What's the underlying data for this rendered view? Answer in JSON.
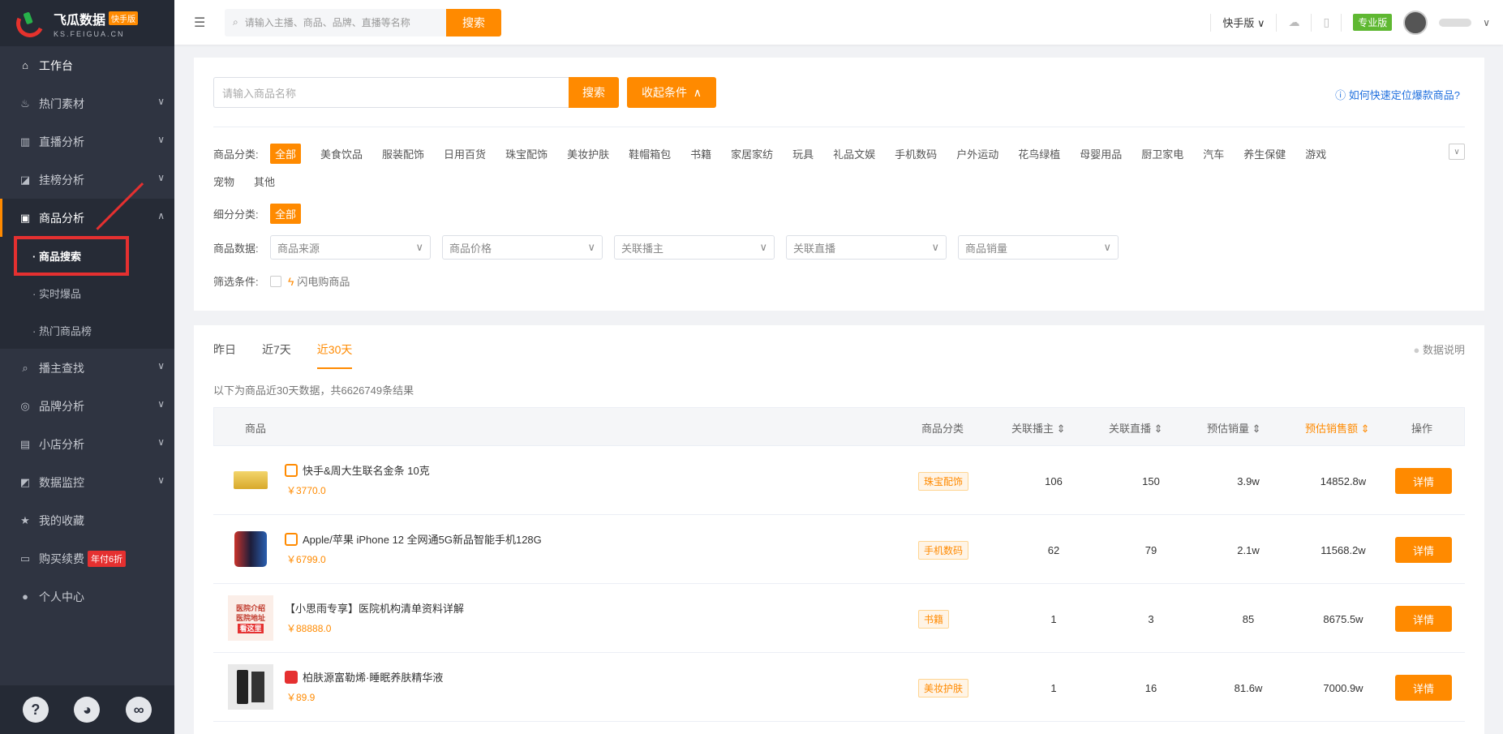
{
  "brand": {
    "name": "飞瓜数据",
    "badge": "快手版",
    "sub": "KS.FEIGUA.CN"
  },
  "sidebar": {
    "items": [
      {
        "label": "工作台",
        "icon": "home-icon"
      },
      {
        "label": "热门素材",
        "icon": "fire-icon"
      },
      {
        "label": "直播分析",
        "icon": "bar-chart-icon"
      },
      {
        "label": "挂榜分析",
        "icon": "trend-icon"
      },
      {
        "label": "商品分析",
        "icon": "bag-icon"
      },
      {
        "label": "播主查找",
        "icon": "search-icon"
      },
      {
        "label": "品牌分析",
        "icon": "brand-icon"
      },
      {
        "label": "小店分析",
        "icon": "store-icon"
      },
      {
        "label": "数据监控",
        "icon": "monitor-icon"
      },
      {
        "label": "我的收藏",
        "icon": "star-icon"
      },
      {
        "label": "购买续费",
        "icon": "card-icon"
      },
      {
        "label": "个人中心",
        "icon": "user-icon"
      }
    ],
    "sub_items": [
      "· 商品搜索",
      "· 实时爆品",
      "· 热门商品榜"
    ],
    "renew_badge": "年付6折"
  },
  "topbar": {
    "search_placeholder": "请输入主播、商品、品牌、直播等名称",
    "search_btn": "搜索",
    "version": "快手版",
    "plan": "专业版"
  },
  "filter": {
    "query_placeholder": "请输入商品名称",
    "query_btn": "搜索",
    "collapse_btn": "收起条件",
    "help": "如何快速定位爆款商品?",
    "category_label": "商品分类:",
    "categories": [
      "全部",
      "美食饮品",
      "服装配饰",
      "日用百货",
      "珠宝配饰",
      "美妆护肤",
      "鞋帽箱包",
      "书籍",
      "家居家纺",
      "玩具",
      "礼品文娱",
      "手机数码",
      "户外运动",
      "花鸟绿植",
      "母婴用品",
      "厨卫家电",
      "汽车",
      "养生保健",
      "游戏",
      "宠物",
      "其他"
    ],
    "subcat_label": "细分分类:",
    "subcat_all": "全部",
    "data_label": "商品数据:",
    "selects": [
      "商品来源",
      "商品价格",
      "关联播主",
      "关联直播",
      "商品销量"
    ],
    "condition_label": "筛选条件:",
    "flash": "闪电购商品"
  },
  "results": {
    "tabs": [
      "昨日",
      "近7天",
      "近30天"
    ],
    "data_note": "数据说明",
    "summary": "以下为商品近30天数据，共6626749条结果",
    "headers": [
      "商品",
      "商品分类",
      "关联播主",
      "关联直播",
      "预估销量",
      "预估销售额",
      "操作"
    ],
    "rows": [
      {
        "name": "快手&周大生联名金条 10克",
        "price": "￥3770.0",
        "category": "珠宝配饰",
        "anchors": "106",
        "lives": "150",
        "sales": "3.9w",
        "revenue": "14852.8w",
        "action": "详情"
      },
      {
        "name": "Apple/苹果 iPhone 12 全网通5G新品智能手机128G",
        "price": "￥6799.0",
        "category": "手机数码",
        "anchors": "62",
        "lives": "79",
        "sales": "2.1w",
        "revenue": "11568.2w",
        "action": "详情"
      },
      {
        "name": "【小思雨专享】医院机构清单资料详解",
        "price": "￥88888.0",
        "category": "书籍",
        "anchors": "1",
        "lives": "3",
        "sales": "85",
        "revenue": "8675.5w",
        "action": "详情"
      },
      {
        "name": "柏肤源富勒烯·睡眠养肤精华液",
        "price": "￥89.9",
        "category": "美妆护肤",
        "anchors": "1",
        "lives": "16",
        "sales": "81.6w",
        "revenue": "7000.9w",
        "action": "详情"
      }
    ],
    "book_cover": [
      "医院介绍",
      "医院地址",
      "看这里"
    ]
  },
  "colors": {
    "accent": "#ff8a00",
    "sidebar": "#2f3441",
    "highlight": "#e53030"
  }
}
